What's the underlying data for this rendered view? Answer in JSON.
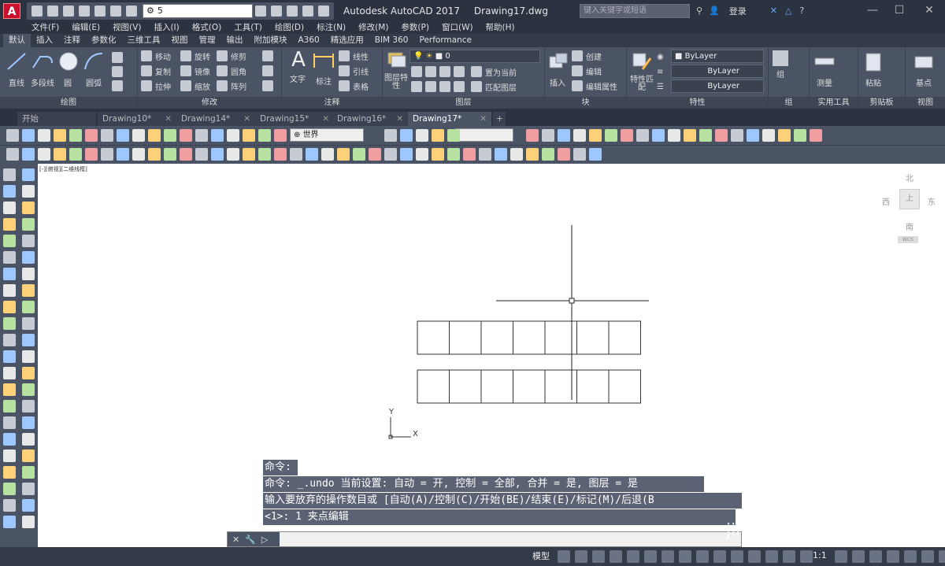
{
  "titlebar": {
    "logo_letter": "A",
    "workspace": "5",
    "app_name": "Autodesk AutoCAD 2017",
    "file_name": "Drawing17.dwg",
    "search_placeholder": "键入关键字或短语",
    "login_label": "登录"
  },
  "menubar": [
    "文件(F)",
    "编辑(E)",
    "视图(V)",
    "插入(I)",
    "格式(O)",
    "工具(T)",
    "绘图(D)",
    "标注(N)",
    "修改(M)",
    "参数(P)",
    "窗口(W)",
    "帮助(H)"
  ],
  "ribbon_tabs": [
    "默认",
    "插入",
    "注释",
    "参数化",
    "三维工具",
    "视图",
    "管理",
    "输出",
    "附加模块",
    "A360",
    "精选应用",
    "BIM 360",
    "Performance"
  ],
  "ribbon": {
    "draw": {
      "title": "绘图",
      "items": [
        "直线",
        "多段线",
        "圆",
        "圆弧"
      ]
    },
    "modify": {
      "title": "修改",
      "items": [
        "移动",
        "旋转",
        "修剪",
        "复制",
        "镜像",
        "圆角",
        "拉伸",
        "缩放",
        "阵列"
      ]
    },
    "annotation": {
      "title": "注释",
      "items": [
        "文字",
        "标注",
        "线性",
        "引线",
        "表格"
      ]
    },
    "layers": {
      "title": "图层",
      "items": [
        "图层特性",
        "置为当前",
        "匹配图层"
      ],
      "current_layer": "0"
    },
    "block": {
      "title": "块",
      "items": [
        "插入",
        "创建",
        "编辑",
        "编辑属性"
      ]
    },
    "properties": {
      "title": "特性",
      "match": "特性匹配",
      "color": "ByLayer",
      "linetype": "ByLayer",
      "lineweight": "ByLayer"
    },
    "groups": {
      "title": "组",
      "items": [
        "组"
      ]
    },
    "utilities": {
      "title": "实用工具",
      "items": [
        "测量"
      ]
    },
    "clipboard": {
      "title": "剪贴板",
      "items": [
        "粘贴"
      ]
    },
    "view": {
      "title": "视图",
      "items": [
        "基点"
      ]
    }
  },
  "doc_tabs": [
    "开始",
    "Drawing10*",
    "Drawing14*",
    "Drawing15*",
    "Drawing16*",
    "Drawing17*"
  ],
  "active_doc": "Drawing17*",
  "toolbar": {
    "ucs_select": "世界"
  },
  "viewport": {
    "label": "[-][俯视][二维线框]",
    "viewcube": {
      "north": "北",
      "south": "南",
      "east": "东",
      "west": "西",
      "top": "上",
      "wcs": "WCS"
    },
    "ucs_x": "X",
    "ucs_y": "Y"
  },
  "command": {
    "history": [
      "命令:",
      "命令: _.undo 当前设置: 自动 = 开, 控制 = 全部, 合并 = 是, 图层 = 是",
      "输入要放弃的操作数目或 [自动(A)/控制(C)/开始(BE)/结束(E)/标记(M)/后退(B",
      "<1>: 1 夹点编辑"
    ],
    "input_value": ""
  },
  "status": {
    "model_label": "模型",
    "scale": "1:1"
  },
  "watermark": "jing"
}
